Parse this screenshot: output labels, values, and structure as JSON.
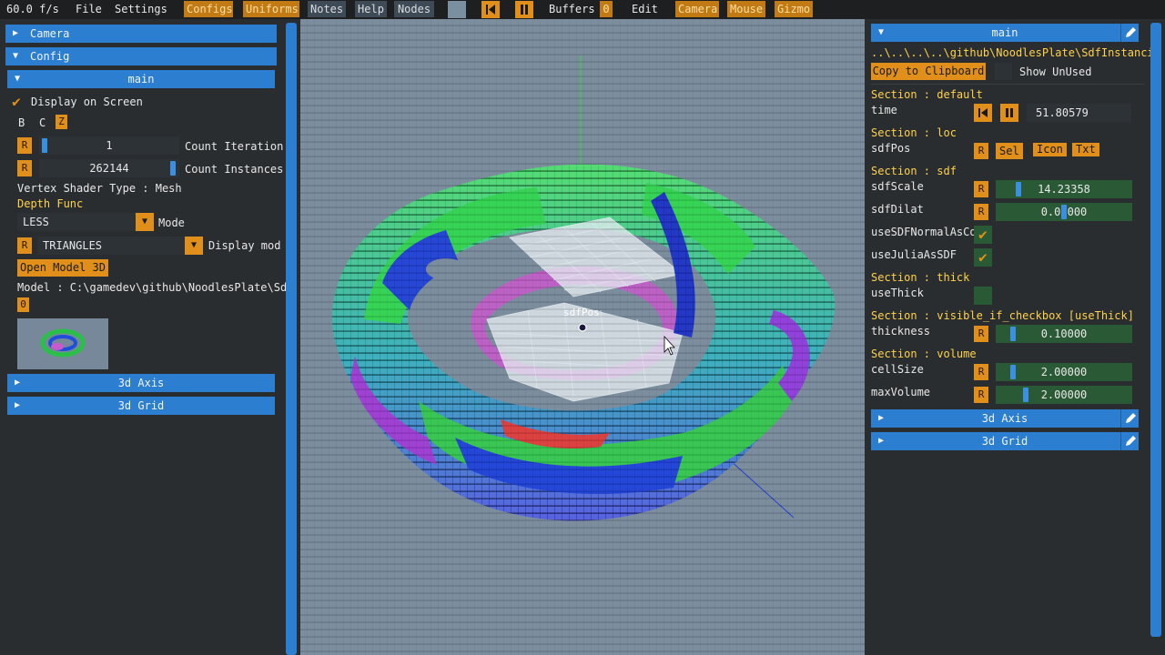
{
  "menubar": {
    "fps": "60.0 f/s",
    "file": "File",
    "settings": "Settings",
    "configs": "Configs",
    "uniforms": "Uniforms",
    "notes": "Notes",
    "help": "Help",
    "nodes": "Nodes",
    "buffers": "Buffers",
    "buffers_count": "0",
    "edit": "Edit",
    "camera": "Camera",
    "mouse": "Mouse",
    "gizmo": "Gizmo"
  },
  "left": {
    "camera": "Camera",
    "config": "Config",
    "main": "main",
    "display_on_screen": "Display on Screen",
    "b": "B",
    "c": "C",
    "z": "Z",
    "r": "R",
    "iter_value": "1",
    "iter_label": "Count Iteration",
    "inst_value": "262144",
    "inst_label": "Count Instances",
    "vertex_shader": "Vertex Shader Type : Mesh",
    "depth_func": "Depth Func",
    "mode_value": "LESS",
    "mode_label": "Mode",
    "display_value": "TRIANGLES",
    "display_label": "Display mod",
    "open_model": "Open Model 3D",
    "model_path": "Model : C:\\gamedev\\github\\NoodlesPlate\\Sd",
    "zero": "0",
    "axis": "3d Axis",
    "grid": "3d Grid"
  },
  "viewport": {
    "gizmo_label": "sdfPos"
  },
  "right": {
    "main": "main",
    "path": "..\\..\\..\\..\\github\\NoodlesPlate\\SdfInstanci",
    "copy": "Copy to Clipboard",
    "show_unused": "Show UnUsed",
    "sec_default": "Section : default",
    "time": "time",
    "time_value": "51.80579",
    "sec_loc": "Section : loc",
    "sdfpos": "sdfPos",
    "r": "R",
    "sel": "Sel",
    "icon": "Icon",
    "txt": "Txt",
    "sec_sdf": "Section : sdf",
    "sdfscale": "sdfScale",
    "sdfscale_value": "14.23358",
    "sdfdilat": "sdfDilat",
    "sdfdilat_value": "0.00000",
    "use_normal": "useSDFNormalAsCo",
    "use_julia": "useJuliaAsSDF",
    "sec_thick": "Section : thick",
    "use_thick": "useThick",
    "sec_visible": "Section : visible_if_checkbox [useThick]",
    "thickness": "thickness",
    "thickness_value": "0.10000",
    "sec_volume": "Section : volume",
    "cellsize": "cellSize",
    "cellsize_value": "2.00000",
    "maxvolume": "maxVolume",
    "maxvolume_value": "2.00000",
    "axis": "3d Axis",
    "grid": "3d Grid"
  }
}
